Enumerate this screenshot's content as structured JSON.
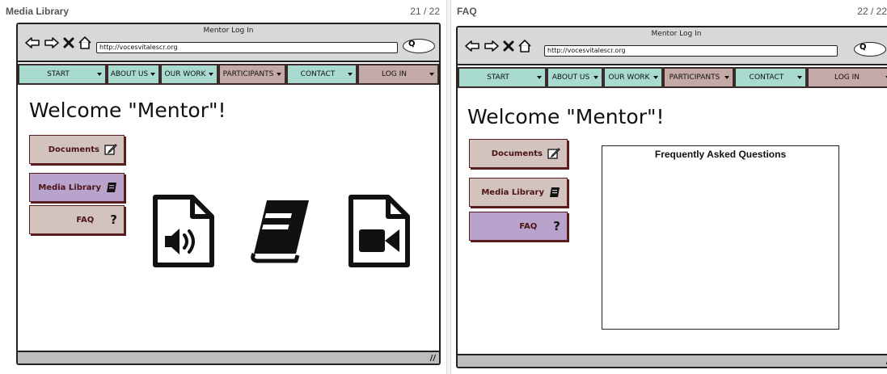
{
  "panels": [
    {
      "title": "Media Library",
      "count": "21 / 22",
      "window_title": "Mentor Log In",
      "url": "http://vocesvitalescr.org",
      "search_symbol": "Q",
      "nav": [
        {
          "label": "START"
        },
        {
          "label": "ABOUT US"
        },
        {
          "label": "OUR WORK"
        },
        {
          "label": "PARTICIPANTS"
        },
        {
          "label": "CONTACT"
        },
        {
          "label": "LOG IN"
        }
      ],
      "welcome": "Welcome \"Mentor\"!",
      "side_buttons": [
        {
          "label": "Documents",
          "icon": "edit-icon"
        },
        {
          "label": "Media Library",
          "icon": "book-icon",
          "active": true
        },
        {
          "label": "FAQ",
          "icon": "question-icon",
          "symbol": "?"
        }
      ],
      "media_icons": [
        "audio-file-icon",
        "book-icon",
        "video-file-icon"
      ],
      "grip": "//"
    },
    {
      "title": "FAQ",
      "count": "22 / 22",
      "window_title": "Mentor Log In",
      "url": "http://vocesvitalescr.org",
      "search_symbol": "Q",
      "nav": [
        {
          "label": "START"
        },
        {
          "label": "ABOUT US"
        },
        {
          "label": "OUR WORK"
        },
        {
          "label": "PARTICIPANTS"
        },
        {
          "label": "CONTACT"
        },
        {
          "label": "LOG IN"
        }
      ],
      "welcome": "Welcome \"Mentor\"!",
      "side_buttons": [
        {
          "label": "Documents",
          "icon": "edit-icon"
        },
        {
          "label": "Media Library",
          "icon": "book-icon"
        },
        {
          "label": "FAQ",
          "icon": "question-icon",
          "symbol": "?",
          "active": true
        }
      ],
      "faq_title": "Frequently Asked Questions",
      "grip": "//"
    }
  ],
  "colors": {
    "teal": "#a8dad0",
    "mauve": "#c4aaa6",
    "button_taupe": "#d3c3bf",
    "button_active_purple": "#b8a3cc",
    "border_maroon": "#5a1d1d"
  }
}
